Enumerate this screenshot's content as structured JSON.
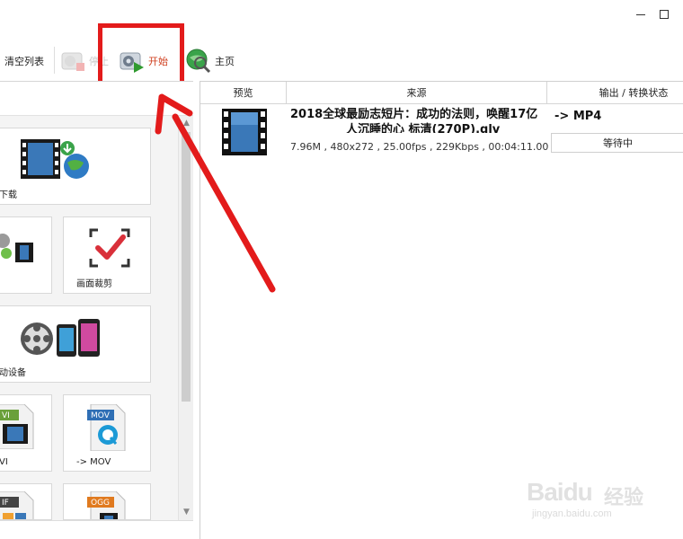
{
  "window": {
    "minimize_label": "minimize",
    "maximize_label": "maximize"
  },
  "toolbar": {
    "clear_list": "清空列表",
    "stop": "停止",
    "start": "开始",
    "home": "主页"
  },
  "left_panel": {
    "tiles": [
      {
        "label": "下载",
        "icon": "download-globe-icon"
      },
      {
        "label": "",
        "icon": "film-convert-icon"
      },
      {
        "label": "画面裁剪",
        "icon": "crop-check-icon"
      },
      {
        "label": "动设备",
        "icon": "mobile-devices-icon"
      },
      {
        "label": "VI",
        "icon": "avi-file-icon"
      },
      {
        "label": "-> MOV",
        "icon": "mov-file-icon"
      },
      {
        "label": "",
        "icon": "gif-file-icon"
      },
      {
        "label": "",
        "icon": "ogg-file-icon"
      }
    ]
  },
  "file_list": {
    "columns": [
      "预览",
      "来源",
      "输出 / 转换状态"
    ],
    "rows": [
      {
        "title_line1": "2018全球最励志短片：成功的法则，唤醒17亿",
        "title_line2": "人沉睡的心 标清(270P).qlv",
        "meta": "7.96M , 480x272 , 25.00fps , 229Kbps , 00:04:11.00",
        "target": "-> MP4",
        "status": "等待中"
      }
    ]
  },
  "watermark": {
    "brand": "Baidu",
    "cn": "经验",
    "sub": "jingyan.baidu.com"
  },
  "colors": {
    "highlight": "#e31b1b",
    "start_text": "#d04020"
  }
}
